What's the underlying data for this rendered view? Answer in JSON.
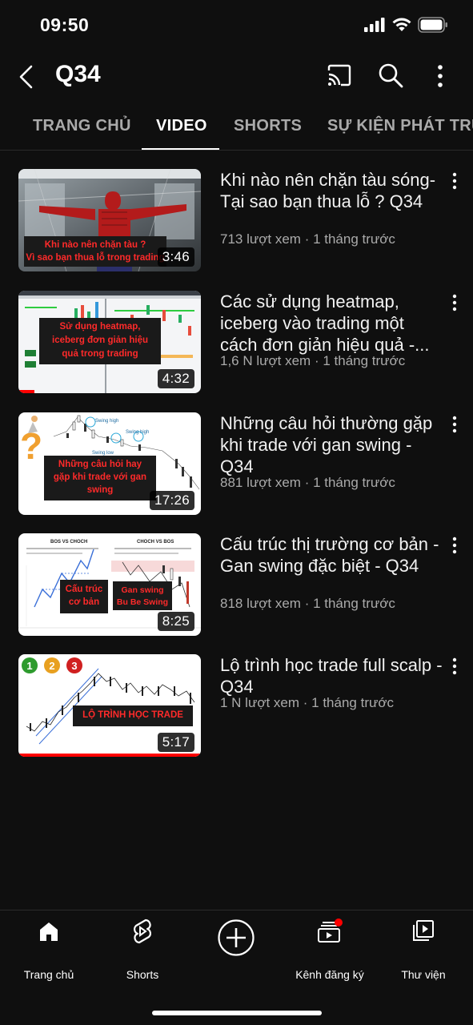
{
  "status": {
    "time": "09:50"
  },
  "header": {
    "title": "Q34",
    "icons": [
      "back-icon",
      "cast-icon",
      "search-icon",
      "more-vert-icon"
    ]
  },
  "tabs": [
    {
      "label": "TRANG CHỦ",
      "active": false
    },
    {
      "label": "VIDEO",
      "active": true
    },
    {
      "label": "SHORTS",
      "active": false
    },
    {
      "label": "SỰ KIỆN PHÁT TRỰ",
      "active": false
    }
  ],
  "videos": [
    {
      "title": "Khi nào nên chặn tàu sóng- Tại sao bạn thua lỗ ? Q34",
      "views": "713 lượt xem",
      "age": "1 tháng trước",
      "duration": "3:46",
      "thumb_text": [
        "Khi nào nên chặn tàu ?",
        "Vì sao bạn thua lỗ trong trading"
      ]
    },
    {
      "title": "Các sử dụng heatmap, iceberg vào trading một cách đơn giản hiệu quả -...",
      "views": "1,6 N lượt xem",
      "age": "1 tháng trước",
      "duration": "4:32",
      "thumb_text": [
        "Sử dụng heatmap,",
        "iceberg đơn giản hiệu",
        "quả trong trading"
      ]
    },
    {
      "title": "Những câu hỏi thường gặp khi trade với gan swing - Q34",
      "views": "881 lượt xem",
      "age": "1 tháng trước",
      "duration": "17:26",
      "thumb_text": [
        "Những câu hỏi hay",
        "gặp khi trade với gan",
        "swing"
      ],
      "thumb_labels": [
        "Swing high",
        "Swing low",
        "Swing high"
      ]
    },
    {
      "title": "Cấu trúc thị trường cơ bản - Gan swing đặc biệt - Q34",
      "views": "818 lượt xem",
      "age": "1 tháng trước",
      "duration": "8:25",
      "thumb_text_left": [
        "Cấu trúc",
        "cơ bản"
      ],
      "thumb_text_right": [
        "Gan swing",
        "Bu Be Swing"
      ],
      "thumb_labels": [
        "BOS VS CHOCH",
        "CHOCH VS BOS"
      ]
    },
    {
      "title": "Lộ trình học trade full scalp - Q34",
      "views": "1 N lượt xem",
      "age": "1 tháng trước",
      "duration": "5:17",
      "thumb_text": [
        "LỘ TRÌNH HỌC TRADE"
      ],
      "thumb_badges": [
        "1",
        "2",
        "3"
      ]
    }
  ],
  "bottom_nav": [
    {
      "label": "Trang chủ",
      "icon": "home-icon"
    },
    {
      "label": "Shorts",
      "icon": "shorts-icon"
    },
    {
      "label": "",
      "icon": "create-plus-icon"
    },
    {
      "label": "Kênh đăng ký",
      "icon": "subscriptions-icon"
    },
    {
      "label": "Thư viện",
      "icon": "library-icon"
    }
  ],
  "colors": {
    "background": "#0f0f0f",
    "text_primary": "#f1f1f1",
    "text_secondary": "#aaaaaa",
    "accent_red": "#ff0000",
    "thumb_label_bg": "#1a1a1a",
    "thumb_label_text": "#ff2a2a"
  }
}
